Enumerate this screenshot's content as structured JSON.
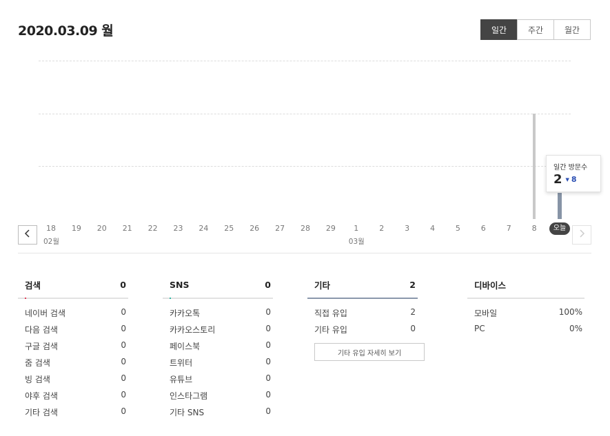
{
  "header": {
    "date_title": "2020.03.09 월"
  },
  "period_toggle": [
    {
      "label": "일간",
      "active": true
    },
    {
      "label": "주간",
      "active": false
    },
    {
      "label": "월간",
      "active": false
    }
  ],
  "chart_data": {
    "type": "bar",
    "categories": [
      "18",
      "19",
      "20",
      "21",
      "22",
      "23",
      "24",
      "25",
      "26",
      "27",
      "28",
      "29",
      "1",
      "2",
      "3",
      "4",
      "5",
      "6",
      "7",
      "8",
      "오늘"
    ],
    "values": [
      0,
      0,
      0,
      0,
      0,
      0,
      0,
      0,
      0,
      0,
      0,
      0,
      0,
      0,
      0,
      0,
      0,
      0,
      0,
      8,
      2
    ],
    "month_labels": [
      {
        "label": "02월",
        "category": "18"
      },
      {
        "label": "03월",
        "category": "1"
      }
    ],
    "ylim": [
      0,
      12
    ],
    "grid": true,
    "highlight_category": "오늘",
    "xlabel": "",
    "ylabel": ""
  },
  "tooltip": {
    "label": "일간 방문수",
    "value": "2",
    "delta": "8",
    "delta_icon": "triangle-down-icon"
  },
  "nav": {
    "prev_icon": "chevron-left-icon",
    "next_icon": "chevron-right-icon",
    "prev_glyph": "〈",
    "next_glyph": "〉"
  },
  "panels": {
    "search": {
      "title": "검색",
      "total": "0",
      "accent_color": "#e0405a",
      "rows": [
        {
          "label": "네이버 검색",
          "value": "0"
        },
        {
          "label": "다음 검색",
          "value": "0"
        },
        {
          "label": "구글 검색",
          "value": "0"
        },
        {
          "label": "줌 검색",
          "value": "0"
        },
        {
          "label": "빙 검색",
          "value": "0"
        },
        {
          "label": "야후 검색",
          "value": "0"
        },
        {
          "label": "기타 검색",
          "value": "0"
        }
      ]
    },
    "sns": {
      "title": "SNS",
      "total": "0",
      "accent_color": "#2bb5a2",
      "rows": [
        {
          "label": "카카오톡",
          "value": "0"
        },
        {
          "label": "카카오스토리",
          "value": "0"
        },
        {
          "label": "페이스북",
          "value": "0"
        },
        {
          "label": "트위터",
          "value": "0"
        },
        {
          "label": "유튜브",
          "value": "0"
        },
        {
          "label": "인스타그램",
          "value": "0"
        },
        {
          "label": "기타 SNS",
          "value": "0"
        }
      ]
    },
    "other": {
      "title": "기타",
      "total": "2",
      "rows": [
        {
          "label": "직접 유입",
          "value": "2"
        },
        {
          "label": "기타 유입",
          "value": "0"
        }
      ],
      "detail_button": "기타 유입 자세히 보기"
    },
    "device": {
      "title": "디바이스",
      "rows": [
        {
          "label": "모바일",
          "value": "100%"
        },
        {
          "label": "PC",
          "value": "0%"
        }
      ]
    }
  }
}
